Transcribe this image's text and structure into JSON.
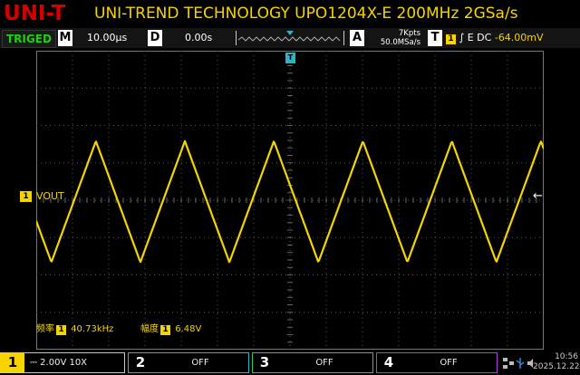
{
  "header": {
    "logo": "UNI-T",
    "title": "UNI-TREND TECHNOLOGY UPO1204X-E  200MHz 2GSa/s"
  },
  "status": {
    "trigger_state": "TRIGED",
    "timebase_key": "M",
    "timebase": "10.00µs",
    "delay_key": "D",
    "delay": "0.00s",
    "acquire_key": "A",
    "memory_depth": "7Kpts",
    "sample_rate": "50.0MSa/s",
    "trigger_key": "T",
    "trigger_source": "1",
    "trigger_slope_coupling": "E DC",
    "trigger_level": "-64.00mV"
  },
  "channel1": {
    "marker": "1",
    "label": "VOUT",
    "color": "#f5d400"
  },
  "trigger_marker": "T",
  "measurements": [
    {
      "name": "频率",
      "source": "1",
      "value": "40.73kHz"
    },
    {
      "name": "幅度",
      "source": "1",
      "value": "6.48V"
    }
  ],
  "channels_bar": [
    {
      "num": "1",
      "value": "2.00V 10X",
      "coupling_icon": "dc-coupling-icon",
      "color": "#f5d400"
    },
    {
      "num": "2",
      "value": "OFF",
      "color": "#2ab3c9"
    },
    {
      "num": "3",
      "value": "OFF",
      "color": "#2ecc40"
    },
    {
      "num": "4",
      "value": "OFF",
      "color": "#b13cd6"
    }
  ],
  "clock": {
    "time": "10:56",
    "date": "2025.12.22"
  },
  "icons": [
    "network-icon",
    "usb-icon",
    "speaker-icon"
  ],
  "waveform": {
    "type": "triangle",
    "frequency": "40.73kHz",
    "amplitude": "6.48V"
  }
}
